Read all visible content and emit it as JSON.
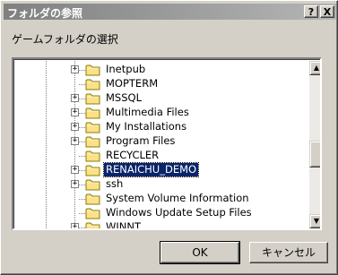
{
  "title_bar": {
    "title": "フォルダの参照",
    "help_glyph": "?",
    "close_glyph": "X"
  },
  "prompt": "ゲームフォルダの選択",
  "tree": {
    "expander_glyph": "+",
    "folder_color": "#ffe08a",
    "selection_color": "#0a246a",
    "items": [
      {
        "label": "Inetpub",
        "expandable": true,
        "selected": false
      },
      {
        "label": "MOPTERM",
        "expandable": false,
        "selected": false
      },
      {
        "label": "MSSQL",
        "expandable": true,
        "selected": false
      },
      {
        "label": "Multimedia Files",
        "expandable": true,
        "selected": false
      },
      {
        "label": "My Installations",
        "expandable": true,
        "selected": false
      },
      {
        "label": "Program Files",
        "expandable": true,
        "selected": false
      },
      {
        "label": "RECYCLER",
        "expandable": false,
        "selected": false
      },
      {
        "label": "RENAICHU_DEMO",
        "expandable": true,
        "selected": true
      },
      {
        "label": "ssh",
        "expandable": true,
        "selected": false
      },
      {
        "label": "System Volume Information",
        "expandable": false,
        "selected": false
      },
      {
        "label": "Windows Update Setup Files",
        "expandable": false,
        "selected": false
      },
      {
        "label": "WINNT",
        "expandable": true,
        "selected": false
      }
    ]
  },
  "scrollbar": {
    "up_glyph": "▲",
    "down_glyph": "▼",
    "position_fraction": 0.58
  },
  "buttons": {
    "ok_label": "OK",
    "cancel_label": "キャンセル"
  }
}
